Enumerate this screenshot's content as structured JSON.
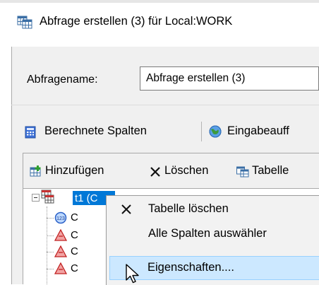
{
  "window": {
    "title": "Abfrage erstellen (3) für Local:WORK",
    "icon": "table-grid-icon"
  },
  "form": {
    "name_label": "Abfragename:",
    "name_value": "Abfrage erstellen (3)"
  },
  "toolbar1": {
    "computed_columns_label": "Berechnete Spalten",
    "computed_columns_icon": "calculator-icon",
    "prompts_label": "Eingabeauff",
    "prompts_icon": "globe-icon"
  },
  "toolbar2": {
    "add_label": "Hinzufügen",
    "add_icon": "add-table-icon",
    "delete_label": "Löschen",
    "delete_icon": "x-icon",
    "tables_label": "Tabelle",
    "tables_icon": "tables-icon"
  },
  "tree": {
    "root_label": "t1 (C",
    "children": [
      {
        "label": "C",
        "icon": "numeric-column-icon"
      },
      {
        "label": "C",
        "icon": "character-column-icon"
      },
      {
        "label": "C",
        "icon": "character-column-icon"
      },
      {
        "label": "C",
        "icon": "character-column-icon"
      }
    ]
  },
  "context_menu": {
    "items": [
      {
        "label": "Tabelle löschen",
        "icon": "delete-x-icon"
      },
      {
        "label": "Alle Spalten auswähler",
        "icon": ""
      },
      {
        "label": "Eigenschaften....",
        "icon": "",
        "highlighted": true
      }
    ]
  },
  "colors": {
    "selection": "#0078d7",
    "menu_highlight": "#cce8ff",
    "window_bg": "#f0f0f0"
  }
}
